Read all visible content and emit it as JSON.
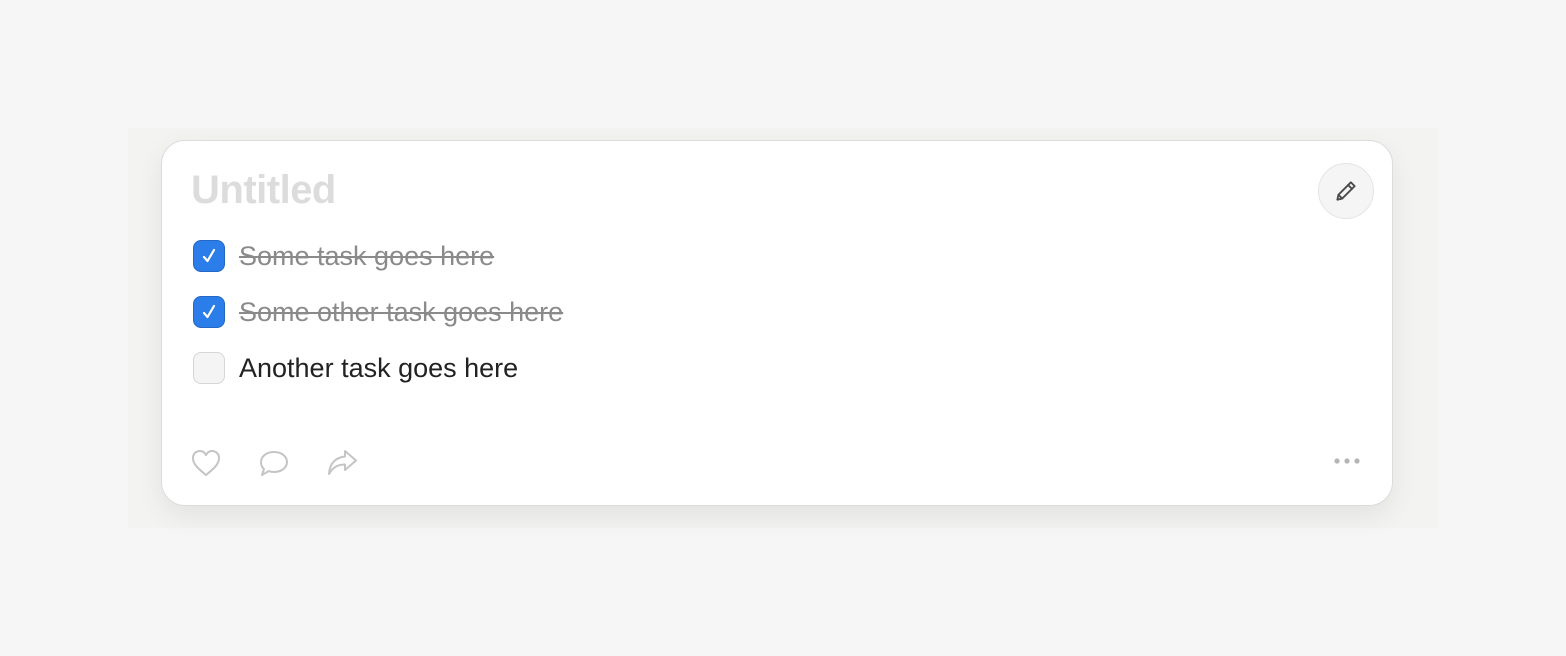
{
  "note": {
    "title": "Untitled",
    "tasks": [
      {
        "label": "Some task goes here",
        "checked": true
      },
      {
        "label": "Some other task goes here",
        "checked": true
      },
      {
        "label": "Another task goes here",
        "checked": false
      }
    ]
  },
  "icons": {
    "edit": "pencil-icon",
    "like": "heart-icon",
    "comment": "comment-icon",
    "share": "share-icon",
    "more": "more-horizontal-icon",
    "check": "checkmark-icon"
  },
  "colors": {
    "checkbox_checked": "#2b7de9",
    "title_placeholder": "#dcdcdc",
    "done_text": "#8a8a8a",
    "text": "#222222",
    "icon": "#c4c4c4"
  }
}
